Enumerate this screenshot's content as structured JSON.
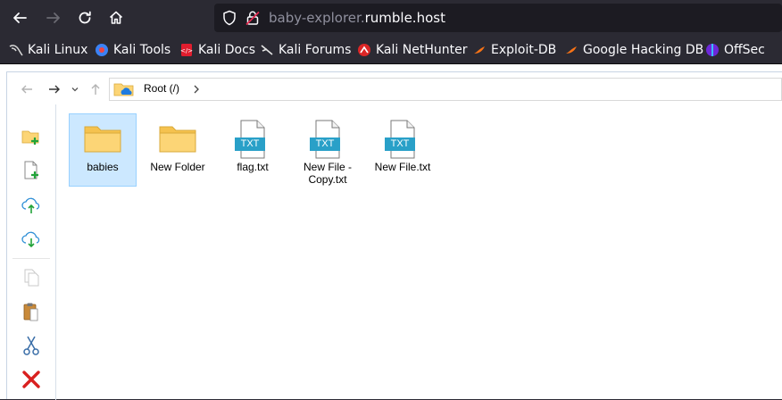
{
  "browser": {
    "url": {
      "prefix": "baby-explorer.",
      "host": "rumble.host"
    },
    "bookmarks": [
      {
        "label": "Kali Linux",
        "icon": "kali-dragon-icon"
      },
      {
        "label": "Kali Tools",
        "icon": "kali-tools-icon"
      },
      {
        "label": "Kali Docs",
        "icon": "kali-docs-icon"
      },
      {
        "label": "Kali Forums",
        "icon": "kali-forums-icon"
      },
      {
        "label": "Kali NetHunter",
        "icon": "nethunter-icon"
      },
      {
        "label": "Exploit-DB",
        "icon": "exploit-db-icon"
      },
      {
        "label": "Google Hacking DB",
        "icon": "ghdb-icon"
      },
      {
        "label": "OffSec",
        "icon": "offsec-icon"
      }
    ]
  },
  "explorer": {
    "breadcrumb": "Root (/)",
    "toolbar": [
      "new-folder-icon",
      "new-file-icon",
      "upload-icon",
      "download-icon",
      "copy-icon",
      "paste-icon",
      "cut-icon",
      "delete-icon"
    ],
    "items": [
      {
        "label": "babies",
        "type": "folder",
        "selected": true
      },
      {
        "label": "New Folder",
        "type": "folder",
        "selected": false
      },
      {
        "label": "flag.txt",
        "type": "file",
        "badge": "TXT",
        "selected": false
      },
      {
        "label": "New File - Copy.txt",
        "type": "file",
        "badge": "TXT",
        "selected": false
      },
      {
        "label": "New File.txt",
        "type": "file",
        "badge": "TXT",
        "selected": false
      }
    ]
  },
  "colors": {
    "chrome_bg": "#2b2a33",
    "urlbar_bg": "#1c1b22",
    "selection": "#cce8ff",
    "txt_badge": "#29a0c8",
    "folder": "#fcd576"
  }
}
